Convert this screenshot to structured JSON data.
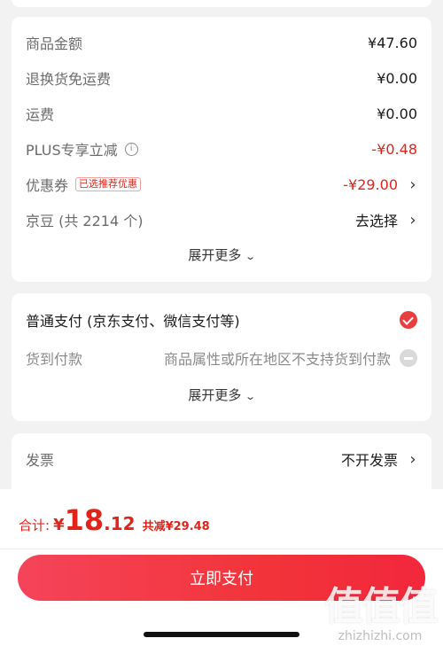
{
  "price_details": {
    "rows": [
      {
        "label": "商品金额",
        "value": "¥47.60"
      },
      {
        "label": "退换货免运费",
        "value": "¥0.00"
      },
      {
        "label": "运费",
        "value": "¥0.00"
      },
      {
        "label": "PLUS专享立减",
        "value": "-¥0.48",
        "info_icon": "ⓘ"
      },
      {
        "label": "优惠券",
        "tag": "已选推荐优惠",
        "value": "-¥29.00",
        "chevron": "›"
      },
      {
        "label": "京豆 (共 2214 个)",
        "value": "去选择",
        "chevron": "›"
      }
    ],
    "expand_label": "展开更多",
    "expand_icon": "⌄"
  },
  "payment": {
    "option_main": "普通支付 (京东支付、微信支付等)",
    "option_cod_label": "货到付款",
    "option_cod_note": "商品属性或所在地区不支持货到付款",
    "expand_label": "展开更多",
    "expand_icon": "⌄"
  },
  "invoice": {
    "label": "发票",
    "value": "不开发票",
    "chevron": "›"
  },
  "footer": {
    "total_label": "合计:",
    "currency": "¥",
    "total_int": "18",
    "total_dec": ".12",
    "discount_text": "共减¥29.48",
    "pay_button": "立即支付"
  },
  "watermark": {
    "big": "值值值",
    "small": "zhizhizhi.com"
  },
  "colors": {
    "accent_red": "#e2231a",
    "button_gradient_start": "#f5445a",
    "button_gradient_end": "#f2273c",
    "background": "#f2f2f2"
  }
}
